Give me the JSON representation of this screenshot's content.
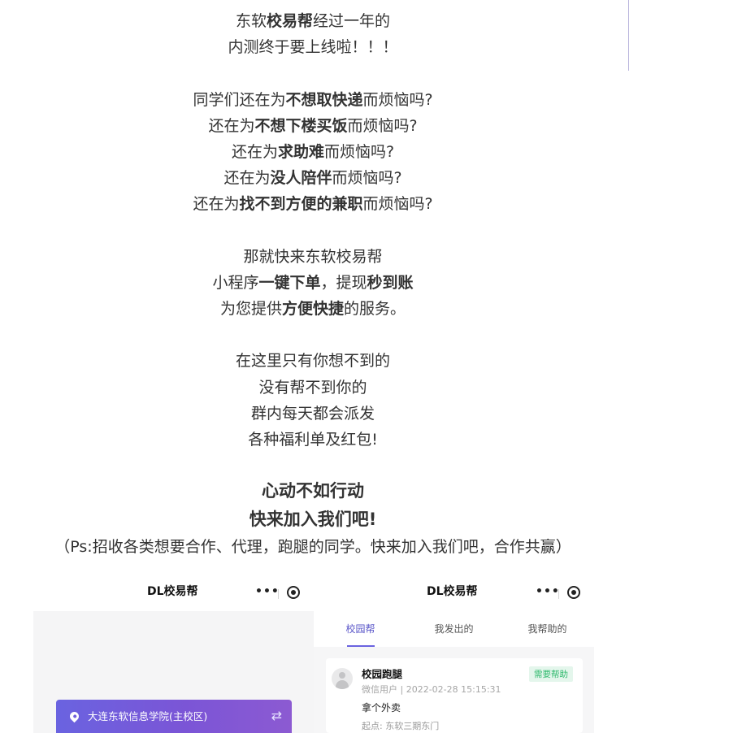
{
  "article": {
    "p1": {
      "l1a": "东软",
      "l1b": "校易帮",
      "l1c": "经过一年的",
      "l2": "内测终于要上线啦！！！"
    },
    "p2": {
      "l1a": "同学们还在为",
      "l1b": "不想取快递",
      "l1c": "而烦恼吗?",
      "l2a": "还在为",
      "l2b": "不想下楼买饭",
      "l2c": "而烦恼吗?",
      "l3a": "还在为",
      "l3b": "求助难",
      "l3c": "而烦恼吗?",
      "l4a": "还在为",
      "l4b": "没人陪伴",
      "l4c": "而烦恼吗?",
      "l5a": "还在为",
      "l5b": "找不到方便的兼职",
      "l5c": "而烦恼吗?"
    },
    "p3": {
      "l1": "那就快来东软校易帮",
      "l2a": "小程序",
      "l2b": "一键下单",
      "l2c": "，提现",
      "l2d": "秒到账",
      "l3a": "为您提供",
      "l3b": "方便快捷",
      "l3c": "的服务。"
    },
    "p4": {
      "l1": "在这里只有你想不到的",
      "l2": "没有帮不到你的",
      "l3": "群内每天都会派发",
      "l4": "各种福利单及红包!"
    },
    "cta": {
      "l1": "心动不如行动",
      "l2": "快来加入我们吧!"
    },
    "ps": "（Ps:招收各类想要合作、代理，跑腿的同学。快来加入我们吧，合作共赢）"
  },
  "screenshot_left": {
    "title": "DL校易帮",
    "menu_dots": "•••",
    "location": "大连东软信息学院(主校区)",
    "swap_glyph": "⇄"
  },
  "screenshot_right": {
    "title": "DL校易帮",
    "menu_dots": "•••",
    "tabs": [
      "校园帮",
      "我发出的",
      "我帮助的"
    ],
    "card": {
      "title": "校园跑腿",
      "meta": "微信用户 | 2022-02-28 15:15:31",
      "body": "拿个外卖",
      "from": "起点: 东软三期东门",
      "badge": "需要帮助"
    }
  }
}
